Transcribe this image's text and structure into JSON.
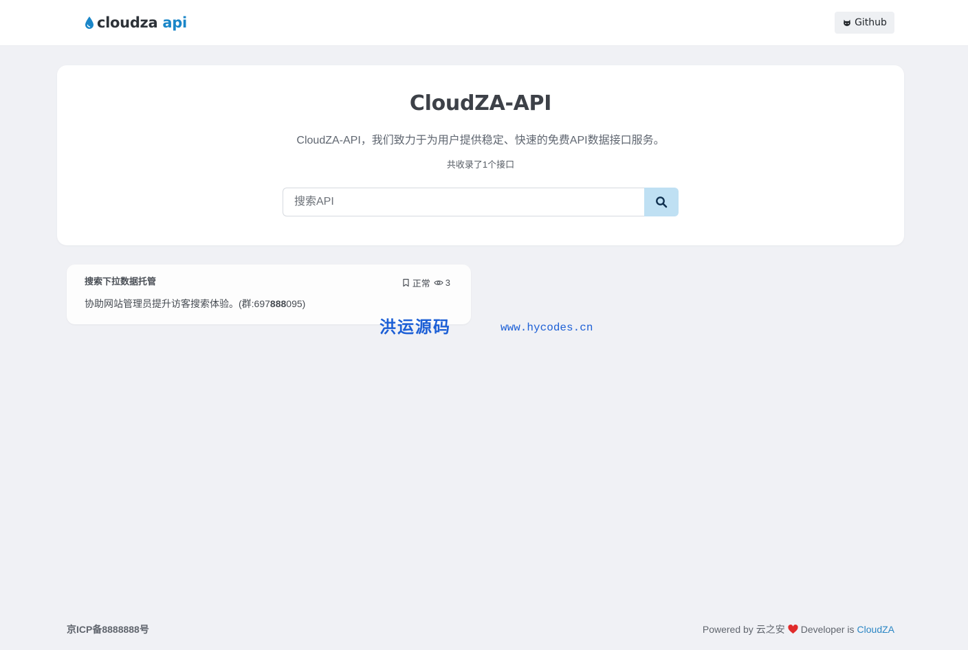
{
  "header": {
    "logo": {
      "text_main": "cloudza",
      "text_accent": "api",
      "accent_color": "#1a86c8"
    },
    "github_button": {
      "label": "Github",
      "icon": "github-icon"
    }
  },
  "hero": {
    "title": "CloudZA-API",
    "subtitle": "CloudZA-API，我们致力于为用户提供稳定、快速的免费API数据接口服务。",
    "count_text": "共收录了1个接口",
    "search": {
      "placeholder": "搜索API",
      "value": "",
      "button_icon": "search-icon",
      "button_color": "#bfe0f3"
    }
  },
  "apis": [
    {
      "name": "搜索下拉数据托管",
      "status": "正常",
      "status_icon": "bookmark-icon",
      "views_icon": "eye-icon",
      "views": "3",
      "desc_prefix": "协助网站管理员提升访客搜索体验。(群:697",
      "desc_bold": "888",
      "desc_suffix": "095)"
    }
  ],
  "watermark": {
    "cn": "洪运源码",
    "url": "www.hycodes.cn"
  },
  "footer": {
    "icp": "京ICP备8888888号",
    "powered_prefix": "Powered by 云之安",
    "heart_icon": "heart-icon",
    "heart_color": "#e02b2b",
    "developer_prefix": "Developer is",
    "developer_link": "CloudZA",
    "link_color": "#2a86c4"
  }
}
